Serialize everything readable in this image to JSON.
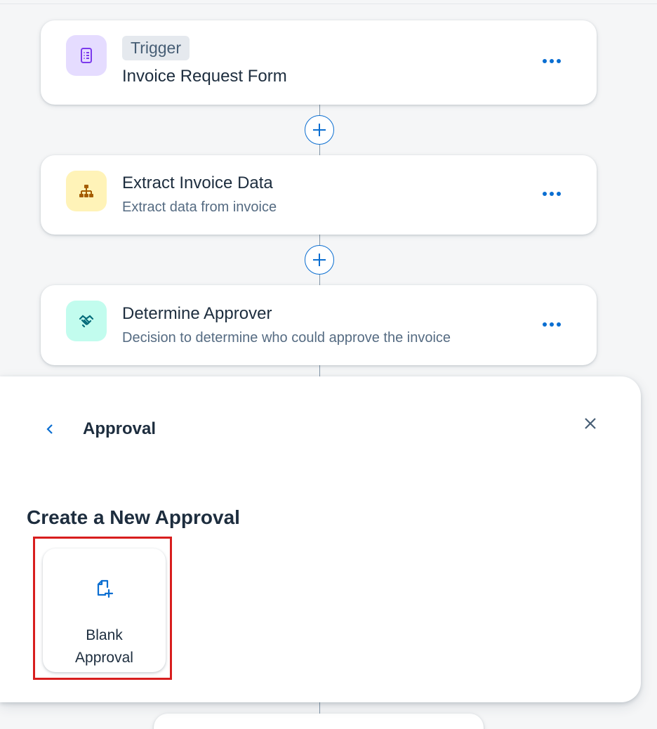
{
  "steps": [
    {
      "tag": "Trigger",
      "title": "Invoice Request Form",
      "subtitle": "",
      "icon": "form-icon",
      "icon_bg": "#e5dcff",
      "icon_color": "#7c3aed"
    },
    {
      "tag": "",
      "title": "Extract Invoice Data",
      "subtitle": "Extract data from invoice",
      "icon": "hierarchy-icon",
      "icon_bg": "#fff3b8",
      "icon_color": "#a45d00"
    },
    {
      "tag": "",
      "title": "Determine Approver",
      "subtitle": "Decision to determine who could approve the invoice",
      "icon": "decision-icon",
      "icon_bg": "#c2fcee",
      "icon_color": "#046c7a"
    }
  ],
  "panel": {
    "title": "Approval",
    "section_heading": "Create a New Approval",
    "tiles": [
      {
        "label_line1": "Blank",
        "label_line2": "Approval",
        "icon": "new-document-icon"
      }
    ]
  },
  "colors": {
    "accent": "#0a6ed1",
    "highlight": "#d81e1e",
    "connector": "#8396a8"
  }
}
